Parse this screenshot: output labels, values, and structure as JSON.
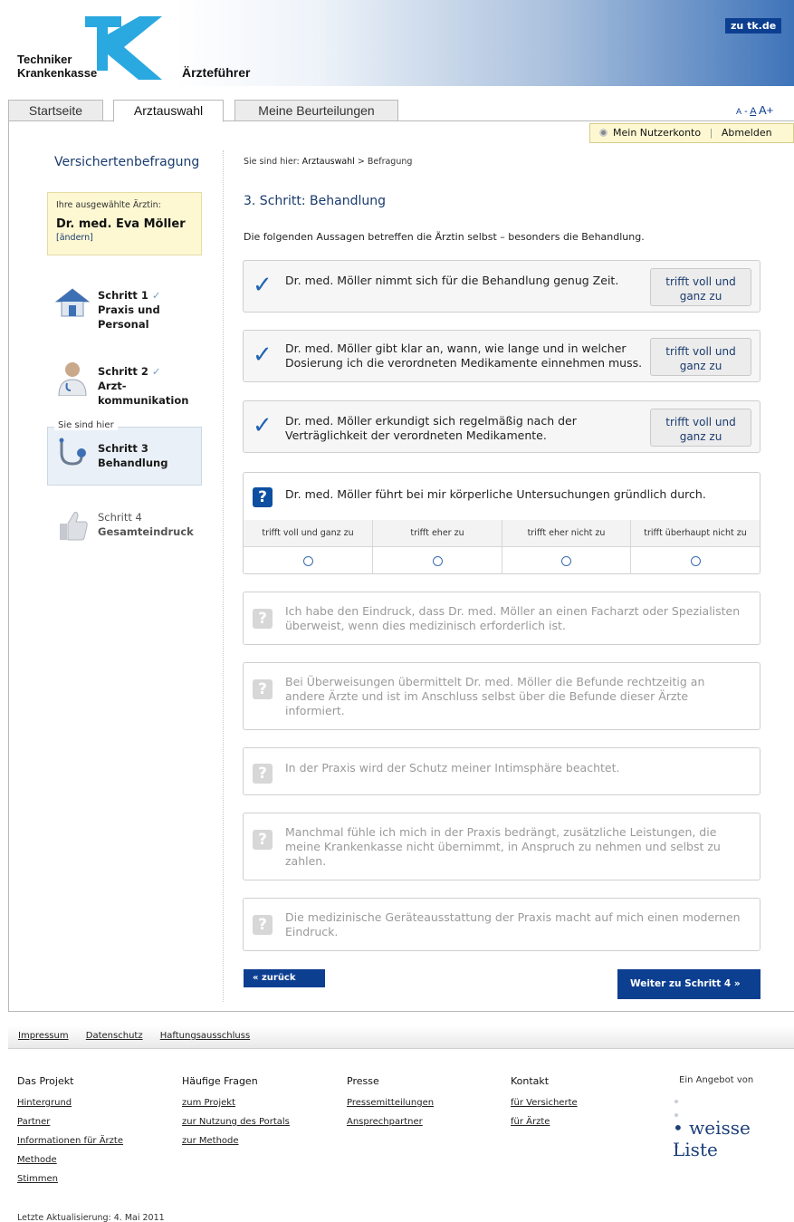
{
  "header": {
    "brand_line1": "Techniker",
    "brand_line2": "Krankenkasse",
    "brand_mark": "TK",
    "product": "Ärzteführer",
    "to_tk": "zu tk.de",
    "colors": {
      "primary": "#0d3f91",
      "accent": "#2aa8e0"
    }
  },
  "tabs": [
    {
      "label": "Startseite",
      "active": false
    },
    {
      "label": "Arztauswahl",
      "active": true
    },
    {
      "label": "Meine Beurteilungen",
      "active": false
    }
  ],
  "font_size": {
    "small": "A",
    "sep": "-",
    "medium": "A",
    "large": "A+"
  },
  "account": {
    "my_account": "Mein Nutzerkonto",
    "sep": "|",
    "logout": "Abmelden"
  },
  "sidebar": {
    "title": "Versichertenbefragung",
    "doctor": {
      "label": "Ihre ausgewählte Ärztin:",
      "name": "Dr. med. Eva Möller",
      "change": "[ändern]"
    },
    "here_label": "Sie sind hier",
    "steps": [
      {
        "num": "Schritt 1",
        "line1": "Praxis und",
        "line2": "Personal",
        "done": true,
        "icon": "house-icon"
      },
      {
        "num": "Schritt 2",
        "line1": "Arzt-",
        "line2": "kommunikation",
        "done": true,
        "icon": "doctor-icon"
      },
      {
        "num": "Schritt 3",
        "line1": "Behandlung",
        "line2": "",
        "done": false,
        "icon": "stethoscope-icon"
      },
      {
        "num": "Schritt 4",
        "line1": "Gesamteindruck",
        "line2": "",
        "done": false,
        "icon": "thumbs-up-icon"
      }
    ],
    "checkmark": "✓"
  },
  "breadcrumb": {
    "prefix": "Sie sind hier:",
    "link": "Arztauswahl",
    "sep": ">",
    "current": "Befragung"
  },
  "main": {
    "heading": "3. Schritt: Behandlung",
    "intro": "Die folgenden Aussagen betreffen die Ärztin selbst – besonders die Behandlung.",
    "answered": [
      {
        "text": "Dr. med. Möller nimmt sich für die Behandlung genug Zeit.",
        "answer_l1": "trifft voll und",
        "answer_l2": "ganz zu"
      },
      {
        "text_l1": "Dr. med. Möller gibt klar an, wann, wie lange und in welcher",
        "text_l2": "Dosierung ich die verordneten Medikamente einnehmen muss.",
        "answer_l1": "trifft voll und",
        "answer_l2": "ganz zu"
      },
      {
        "text_l1": "Dr. med. Möller erkundigt sich regelmäßig nach der",
        "text_l2": "Verträglichkeit der verordneten Medikamente.",
        "answer_l1": "trifft voll und",
        "answer_l2": "ganz zu"
      }
    ],
    "current": {
      "text": "Dr. med. Möller führt bei mir körperliche Untersuchungen gründlich durch.",
      "options": [
        "trifft voll und ganz zu",
        "trifft eher zu",
        "trifft eher nicht zu",
        "trifft überhaupt nicht zu"
      ]
    },
    "upcoming": [
      {
        "l1": "Ich habe den Eindruck, dass Dr. med. Möller an einen Facharzt oder Spezialisten",
        "l2": "überweist, wenn dies medizinisch erforderlich ist.",
        "l3": ""
      },
      {
        "l1": "Bei Überweisungen übermittelt Dr. med. Möller die Befunde rechtzeitig an",
        "l2": "andere Ärzte und ist im Anschluss selbst über die Befunde dieser Ärzte",
        "l3": "informiert."
      },
      {
        "l1": "In der Praxis wird der Schutz meiner Intimsphäre beachtet.",
        "l2": "",
        "l3": ""
      },
      {
        "l1": "Manchmal fühle ich mich in der Praxis bedrängt, zusätzliche Leistungen, die",
        "l2": "meine Krankenkasse nicht übernimmt, in Anspruch zu nehmen und selbst zu",
        "l3": "zahlen."
      },
      {
        "l1": "Die medizinische Geräteausstattung der Praxis macht auf mich einen modernen",
        "l2": "Eindruck.",
        "l3": ""
      }
    ],
    "question_mark": "?",
    "back": "«  zurück",
    "next": "Weiter zu Schritt 4  »"
  },
  "footer": {
    "links": [
      "Impressum",
      "Datenschutz",
      "Haftungsausschluss"
    ],
    "columns": [
      {
        "heading": "Das Projekt",
        "items": [
          "Hintergrund",
          "Partner",
          "Informationen für Ärzte",
          "Methode",
          "Stimmen"
        ]
      },
      {
        "heading": "Häufige Fragen",
        "items": [
          "zum Projekt",
          "zur Nutzung des Portals",
          "zur Methode"
        ]
      },
      {
        "heading": "Presse",
        "items": [
          "Pressemitteilungen",
          "Ansprechpartner"
        ]
      },
      {
        "heading": "Kontakt",
        "items": [
          "für Versicherte",
          "für Ärzte"
        ]
      }
    ],
    "offer": "Ein Angebot von",
    "partner_logo": "• weisse Liste",
    "updated": "Letzte Aktualisierung: 4. Mai 2011"
  }
}
